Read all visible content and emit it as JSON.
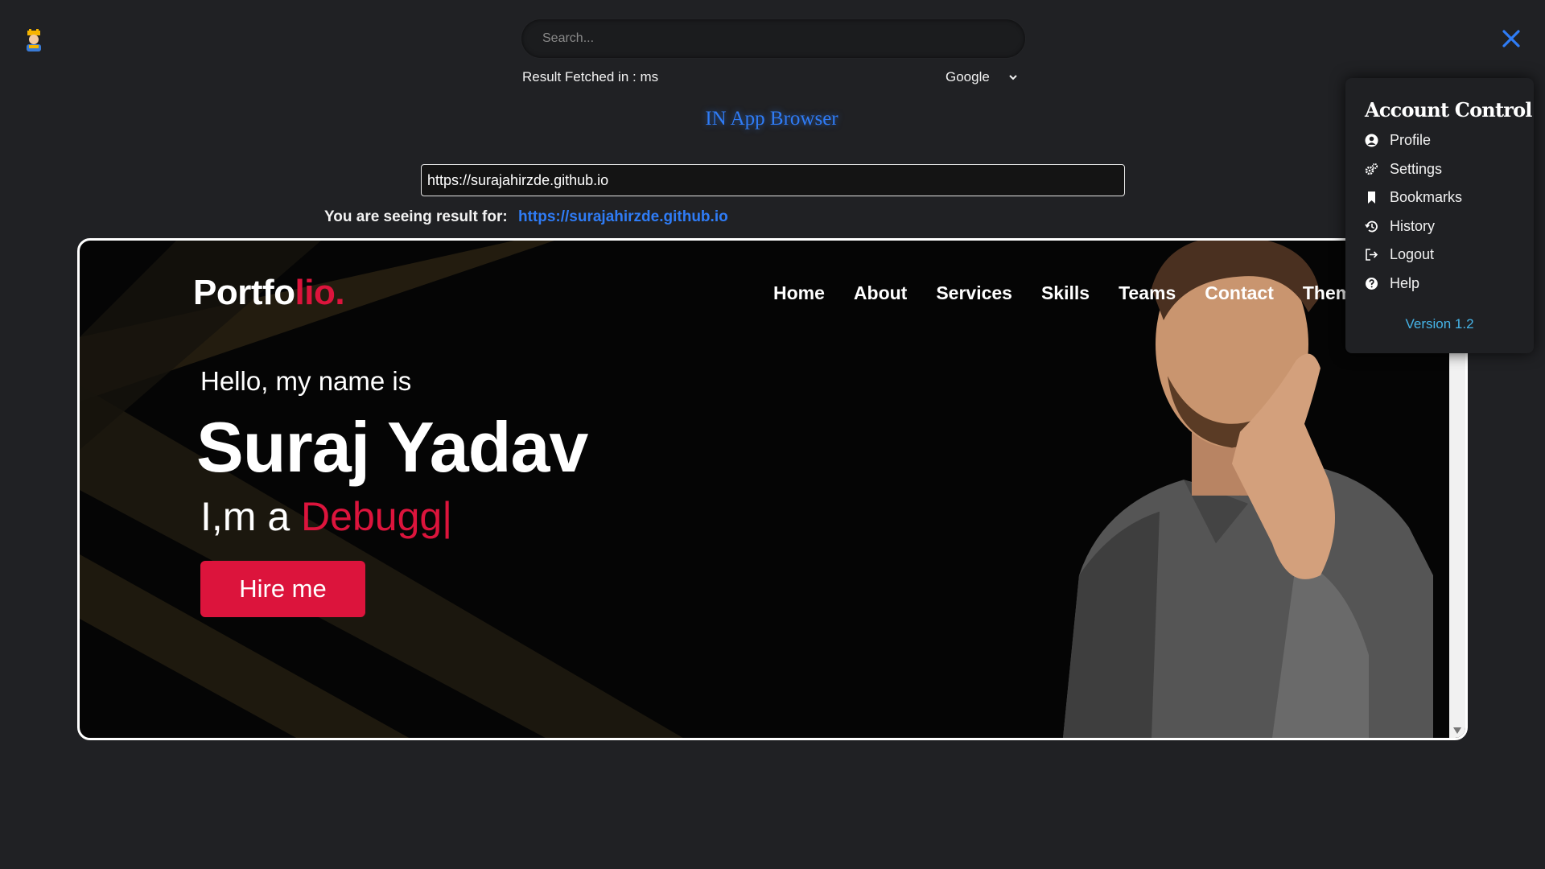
{
  "search": {
    "placeholder": "Search...",
    "fetch_info": "Result Fetched in : ms",
    "engine": "Google"
  },
  "app": {
    "title": "IN App Browser",
    "url_value": "https://surajahirzde.github.io",
    "result_prefix": "You are seeing result for:",
    "result_url": "https://surajahirzde.github.io"
  },
  "site": {
    "logo_main": "Portfo",
    "logo_accent": "lio.",
    "nav": [
      "Home",
      "About",
      "Services",
      "Skills",
      "Teams",
      "Contact",
      "Theme"
    ],
    "hello": "Hello, my name is",
    "name": "Suraj Yadav",
    "role_prefix": "I,m a ",
    "role_typed": "Debugg|",
    "hire_label": "Hire me"
  },
  "account": {
    "title": "Account Control",
    "items": [
      {
        "label": "Profile",
        "icon": "user-circle-icon"
      },
      {
        "label": "Settings",
        "icon": "gears-icon"
      },
      {
        "label": "Bookmarks",
        "icon": "bookmark-icon"
      },
      {
        "label": "History",
        "icon": "history-icon"
      },
      {
        "label": "Logout",
        "icon": "logout-icon"
      },
      {
        "label": "Help",
        "icon": "help-icon"
      }
    ],
    "version": "Version 1.2"
  },
  "colors": {
    "accent_blue": "#2f7cf6",
    "brand_red": "#dc143c",
    "version_cyan": "#46b4e8",
    "page_bg": "#202124"
  }
}
